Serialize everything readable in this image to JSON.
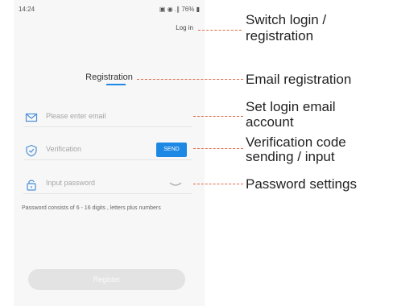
{
  "status_bar": {
    "time": "14:24",
    "right_icons": "▣ ◉ .∥ 76% ▮"
  },
  "header": {
    "login_link": "Log in"
  },
  "form": {
    "title": "Registration",
    "email_placeholder": "Please enter email",
    "verification_placeholder": "Verification",
    "send_label": "SEND",
    "password_placeholder": "Input password",
    "password_hint": "Password consists of 6 - 16 digits , letters plus numbers",
    "register_label": "Register"
  },
  "annotations": {
    "switch_login_1": "Switch login /",
    "switch_login_2": "registration",
    "email_registration": "Email registration",
    "set_login_1": "Set login email",
    "set_login_2": "account",
    "verification_1": "Verification code",
    "verification_2": "sending / input",
    "password_settings": "Password settings"
  },
  "colors": {
    "accent": "#1e88e5",
    "callout": "#e06a4a",
    "button_disabled": "#e3e3e3"
  }
}
